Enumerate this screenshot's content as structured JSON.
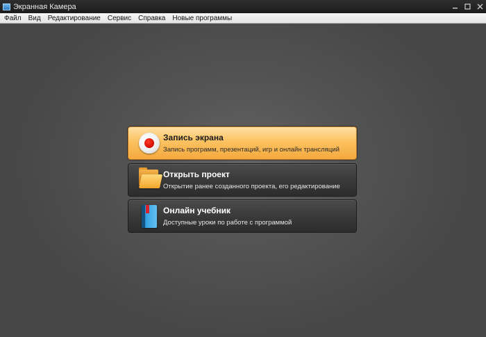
{
  "window": {
    "title": "Экранная Камера",
    "controls": [
      "minimize-icon",
      "maximize-icon",
      "close-icon"
    ]
  },
  "menu": {
    "items": [
      "Файл",
      "Вид",
      "Редактирование",
      "Сервис",
      "Справка",
      "Новые программы"
    ]
  },
  "start_panel": {
    "cards": [
      {
        "title": "Запись экрана",
        "subtitle": "Запись программ, презентаций, игр и онлайн трансляций",
        "icon": "record-icon"
      },
      {
        "title": "Открыть проект",
        "subtitle": "Открытие ранее созданного проекта, его редактирование",
        "icon": "folder-icon"
      },
      {
        "title": "Онлайн учебник",
        "subtitle": "Доступные уроки по работе с программой",
        "icon": "book-icon"
      }
    ]
  },
  "colors": {
    "accent": "#fcc260",
    "background": "#545454",
    "card_dark": "#3a3a3a",
    "record_red": "#d10c00"
  }
}
